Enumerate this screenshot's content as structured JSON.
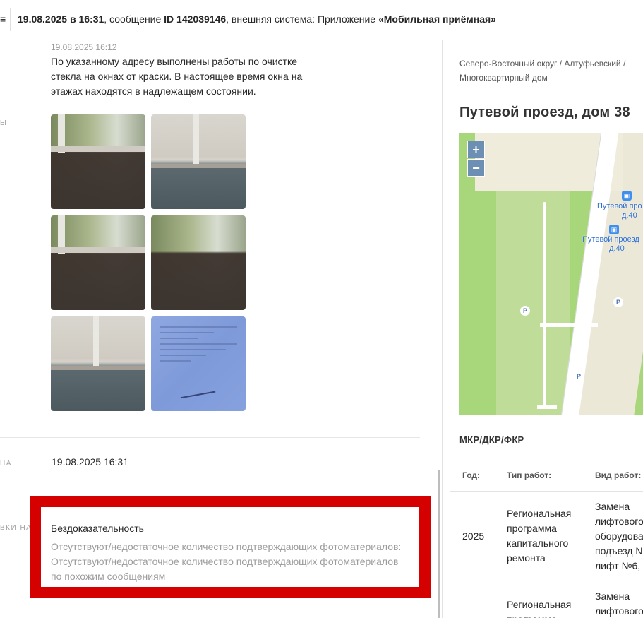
{
  "header": {
    "edge_glyph": "≡",
    "datetime": "19.08.2025 в 16:31",
    "message_prefix": ", сообщение ",
    "message_id": "ID 142039146",
    "system_prefix": ", внешняя система: Приложение ",
    "system_name": "«Мобильная приёмная»"
  },
  "message": {
    "date": "19.08.2025 16:12",
    "text": "По указанному адресу выполнены работы по очистке стекла на окнах от краски. В настоящее время окна на этажах находятся в надлежащем состоянии.",
    "photos": [
      "photo-1",
      "photo-2",
      "photo-3",
      "photo-4",
      "photo-5",
      "document-photo"
    ]
  },
  "sidebar_fragments": {
    "label_1": "ы",
    "label_2": "на",
    "label_3": "вки на"
  },
  "date_field": "19.08.2025 16:31",
  "rejection": {
    "title": "Бездоказательность",
    "description": "Отсутствуют/недостаточное количество подтверждающих фотоматериалов: Отсутствуют/недостаточное количество подтверждающих фотоматериалов по похожим сообщениям"
  },
  "location": {
    "breadcrumb_line1": "Северо-Восточный округ / Алтуфьевский /",
    "breadcrumb_line2": "Многоквартирный дом",
    "address": "Путевой проезд, дом 38",
    "map": {
      "zoom_in": "+",
      "zoom_out": "−",
      "parking": "P",
      "bus_stop_1_line1": "Путевой про",
      "bus_stop_1_line2": "д.40",
      "bus_stop_2_line1": "Путевой проезд",
      "bus_stop_2_line2": "д.40"
    }
  },
  "works": {
    "section_title": "МКР/ДКР/ФКР",
    "headers": {
      "year": "Год:",
      "type": "Тип работ:",
      "kind": "Вид работ:"
    },
    "rows": [
      {
        "year": "2025",
        "type": "Региональная программа капитального ремонта",
        "kind": "Замена лифтового оборудова подъезд N лифт №6, б"
      },
      {
        "year": "",
        "type": "Региональная программа",
        "kind": "Замена лифтового"
      }
    ]
  }
}
